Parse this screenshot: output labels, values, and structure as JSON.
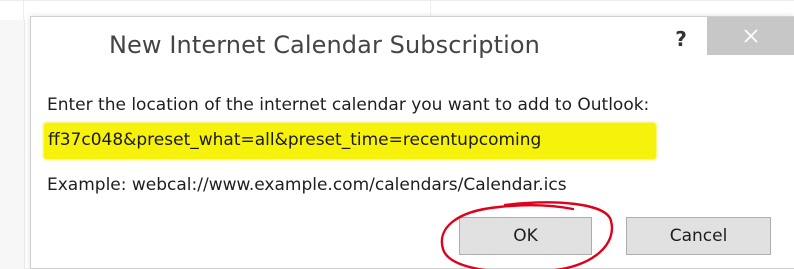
{
  "dialog": {
    "title": "New Internet Calendar Subscription",
    "help_label": "?",
    "close_icon": "close-icon"
  },
  "form": {
    "prompt": "Enter the location of the internet calendar you want to add to Outlook:",
    "url_value": "ff37c048&preset_what=all&preset_time=recentupcoming",
    "example": "Example: webcal://www.example.com/calendars/Calendar.ics"
  },
  "buttons": {
    "ok_label": "OK",
    "cancel_label": "Cancel"
  },
  "colors": {
    "highlight": "#f7f20c",
    "annotation_circle": "#e0001b",
    "close_bg": "#c7c7c7"
  }
}
